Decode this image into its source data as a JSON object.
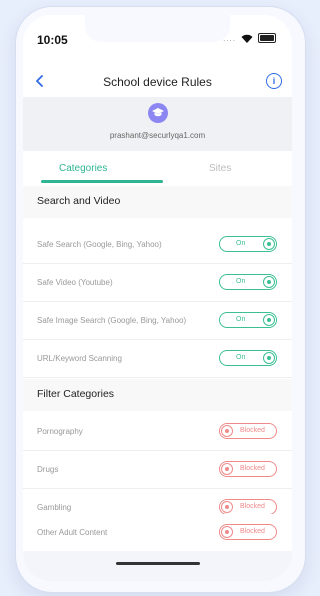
{
  "status": {
    "time": "10:05",
    "signal_dots": "...."
  },
  "header": {
    "title": "School device Rules",
    "info_glyph": "i"
  },
  "profile": {
    "email": "prashant@securlyqa1.com"
  },
  "tabs": [
    {
      "label": "Categories",
      "active": true
    },
    {
      "label": "Sites",
      "active": false
    }
  ],
  "search_and_video": {
    "title": "Search and Video",
    "items": [
      {
        "label": "Safe Search (Google, Bing, Yahoo)",
        "state": "On"
      },
      {
        "label": "Safe Video (Youtube)",
        "state": "On"
      },
      {
        "label": "Safe Image Search (Google, Bing, Yahoo)",
        "state": "On"
      },
      {
        "label": "URL/Keyword Scanning",
        "state": "On"
      }
    ]
  },
  "filter_categories": {
    "title": "Filter Categories",
    "items": [
      {
        "label": "Pornography",
        "state": "Blocked"
      },
      {
        "label": "Drugs",
        "state": "Blocked"
      },
      {
        "label": "Gambling",
        "state": "Blocked"
      },
      {
        "label": "Other Adult Content",
        "state": "Blocked"
      }
    ]
  },
  "colors": {
    "accent_green": "#3bbf93",
    "blocked_red": "#f08a8a",
    "info_blue": "#2d6be4",
    "avatar_purple": "#8c86f2"
  },
  "icons": [
    "back-arrow-icon",
    "info-icon",
    "graduation-cap-icon",
    "wifi-icon",
    "battery-icon"
  ]
}
